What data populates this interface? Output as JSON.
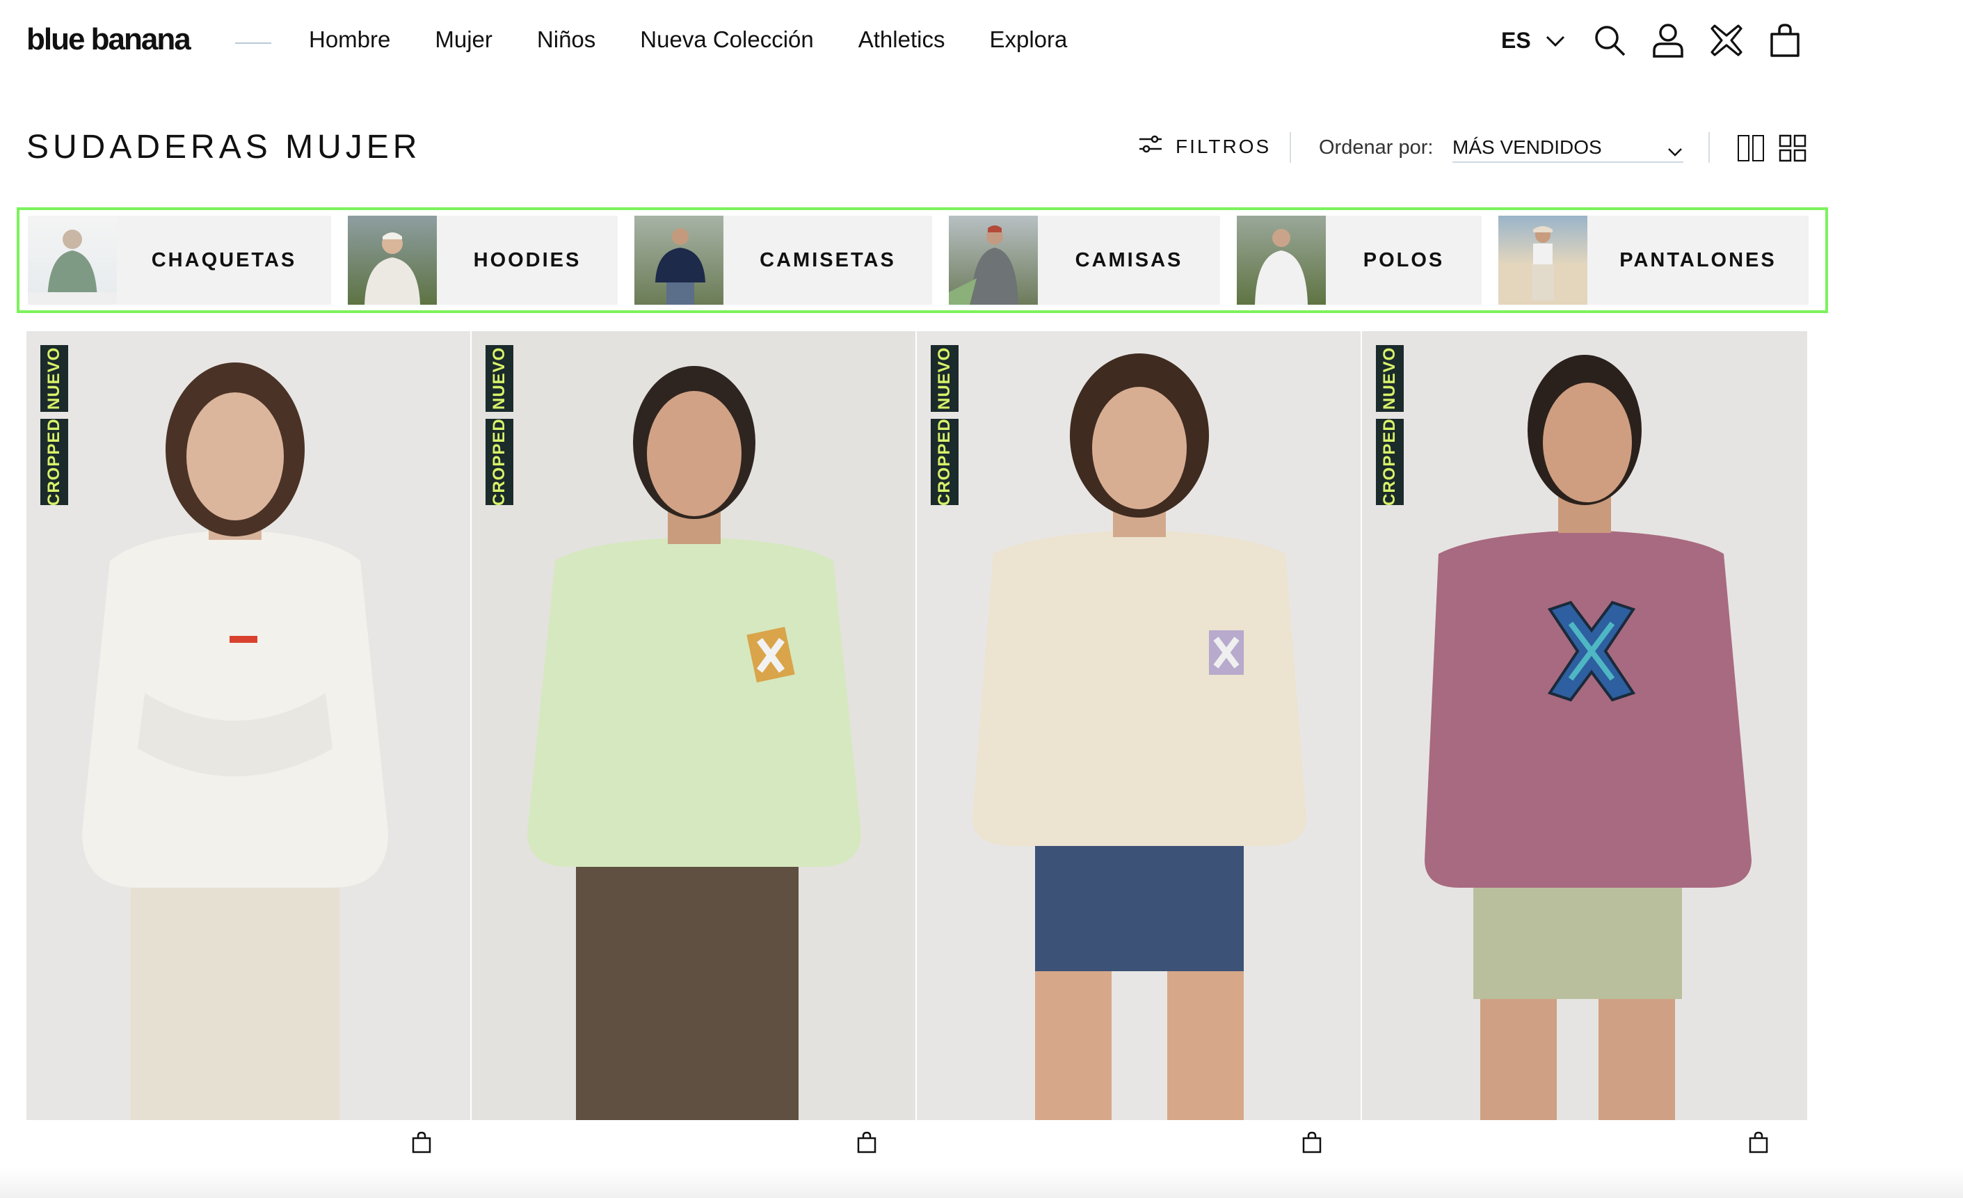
{
  "brand": {
    "logo": "blue banana"
  },
  "nav": {
    "items": [
      "Hombre",
      "Mujer",
      "Niños",
      "Nueva Colección",
      "Athletics",
      "Explora"
    ]
  },
  "header": {
    "language": "ES",
    "icons": [
      "search-icon",
      "user-icon",
      "brand-x-icon",
      "cart-icon"
    ]
  },
  "page": {
    "title": "SUDADERAS MUJER",
    "filters_label": "FILTROS",
    "sort_label": "Ordenar por:",
    "sort_value": "MÁS VENDIDOS"
  },
  "categories": [
    {
      "label": "CHAQUETAS",
      "thumb_color": "#7f9a84"
    },
    {
      "label": "HOODIES",
      "thumb_color": "#e9e6e0"
    },
    {
      "label": "CAMISETAS",
      "thumb_color": "#1e2a4a"
    },
    {
      "label": "CAMISAS",
      "thumb_color": "#6e7375"
    },
    {
      "label": "POLOS",
      "thumb_color": "#eeeeee"
    },
    {
      "label": "PANTALONES",
      "thumb_color": "#dcd3c2"
    }
  ],
  "products": [
    {
      "badges": [
        "NUEVO",
        "CROPPED"
      ],
      "sweater_color": "#f3f1ec",
      "pants_color": "#e6e0d2",
      "bg": "#e8e6e4"
    },
    {
      "badges": [
        "NUEVO",
        "CROPPED"
      ],
      "sweater_color": "#d6e8bf",
      "pants_color": "#5f5041",
      "bg": "#e4e2df"
    },
    {
      "badges": [
        "NUEVO",
        "CROPPED"
      ],
      "sweater_color": "#ece3d0",
      "pants_color": "#3c5276",
      "bg": "#e8e6e4"
    },
    {
      "badges": [
        "NUEVO",
        "CROPPED"
      ],
      "sweater_color": "#a86a80",
      "pants_color": "#b9bf9c",
      "bg": "#e6e4e2"
    }
  ],
  "colors": {
    "accent_highlight": "#7cf25c",
    "badge_bg": "#1b2a2b",
    "badge_text": "#d8f26a"
  }
}
